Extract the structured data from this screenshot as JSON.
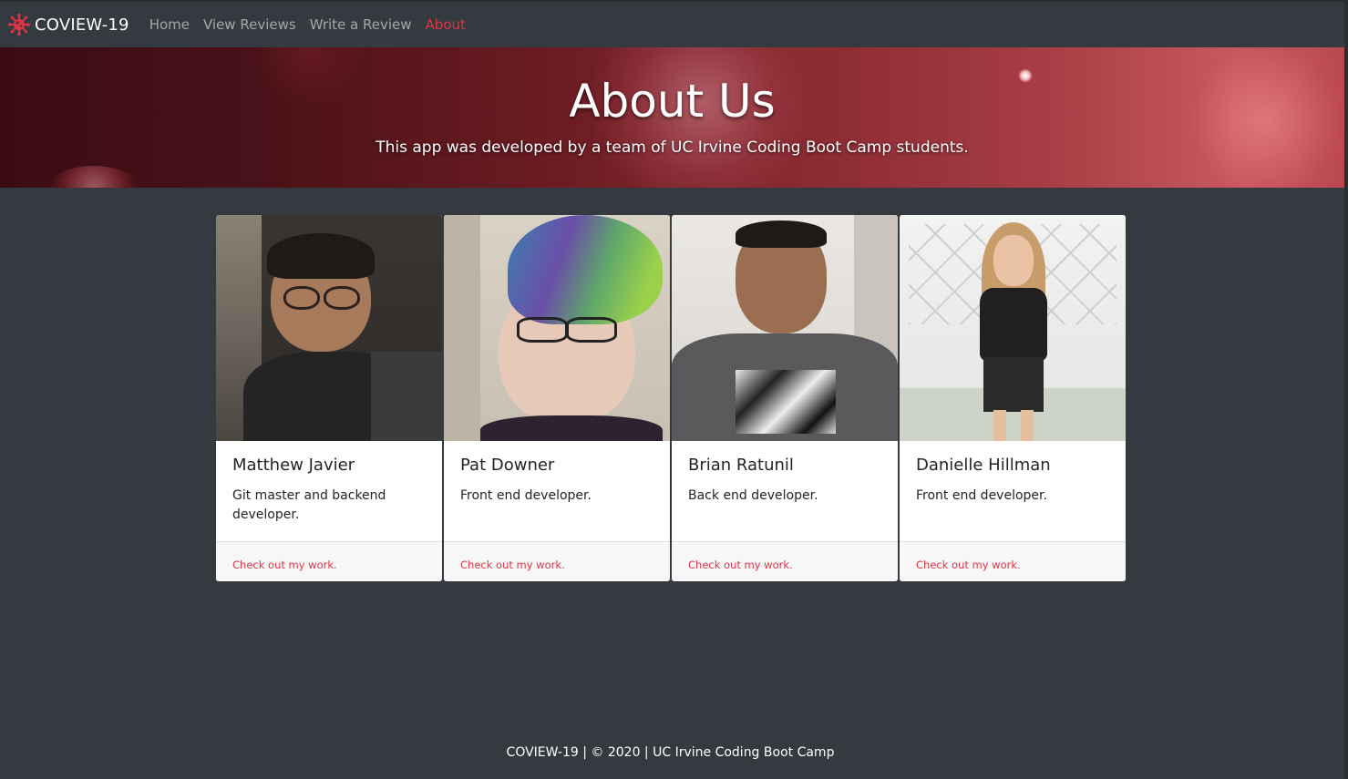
{
  "nav": {
    "brand": "COVIEW-19",
    "links": [
      {
        "label": "Home",
        "active": false
      },
      {
        "label": "View Reviews",
        "active": false
      },
      {
        "label": "Write a Review",
        "active": false
      },
      {
        "label": "About",
        "active": true
      }
    ]
  },
  "hero": {
    "title": "About Us",
    "subtitle": "This app was developed by a team of UC Irvine Coding Boot Camp students."
  },
  "team": [
    {
      "name": "Matthew Javier",
      "role": "Git master and backend developer.",
      "link": "Check out my work."
    },
    {
      "name": "Pat Downer",
      "role": "Front end developer.",
      "link": "Check out my work."
    },
    {
      "name": "Brian Ratunil",
      "role": "Back end developer.",
      "link": "Check out my work."
    },
    {
      "name": "Danielle Hillman",
      "role": "Front end developer.",
      "link": "Check out my work."
    }
  ],
  "footer": {
    "text": "COVIEW-19 | © 2020 | UC Irvine Coding Boot Camp"
  },
  "colors": {
    "background": "#343a40",
    "accent": "#dc3545",
    "card": "#ffffff",
    "card_footer": "#f7f7f7"
  },
  "icons": {
    "brand": "virus-icon"
  }
}
